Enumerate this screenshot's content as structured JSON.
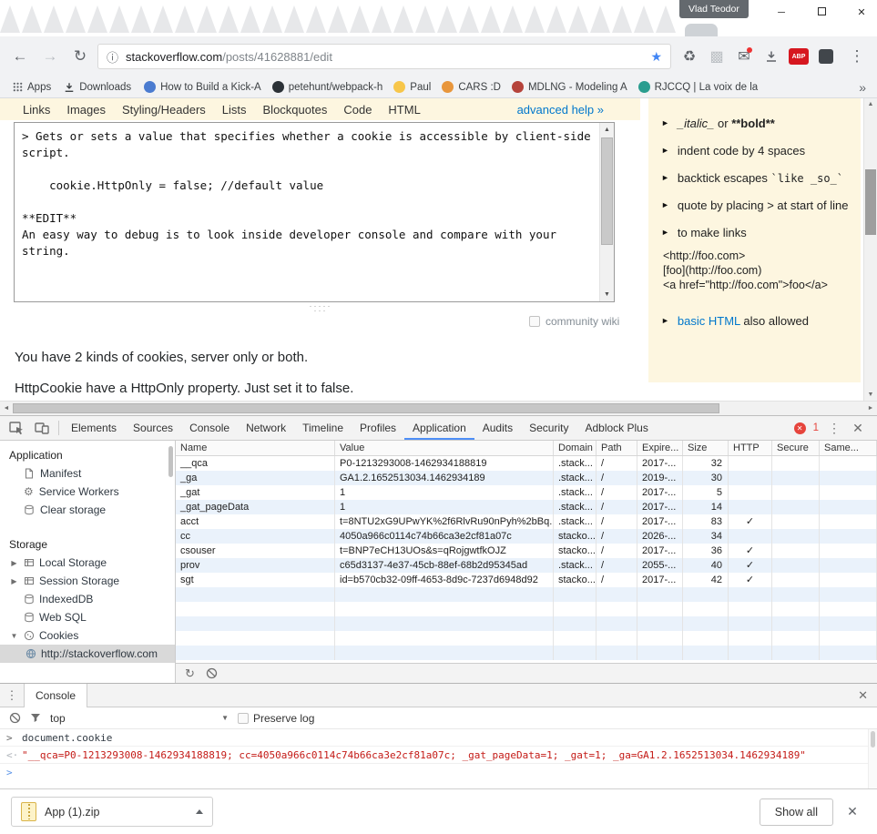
{
  "titlebar": {
    "profile_name": "Vlad Teodor"
  },
  "navbar": {
    "url_host": "stackoverflow.com",
    "url_path": "/posts/41628881/edit",
    "abp_label": "ABP"
  },
  "bookmarks_bar": {
    "apps_label": "Apps",
    "downloads_label": "Downloads",
    "items": [
      {
        "label": "How to Build a Kick-A",
        "color": "#4a7bd0"
      },
      {
        "label": "petehunt/webpack-h",
        "color": "#2b3137"
      },
      {
        "label": "Paul",
        "color": "#f7c64a"
      },
      {
        "label": "CARS :D",
        "color": "#e8963c"
      },
      {
        "label": "MDLNG - Modeling A",
        "color": "#b5433b"
      },
      {
        "label": "RJCCQ | La voix de la",
        "color": "#2a9d8f"
      }
    ],
    "overflow": "»"
  },
  "editor": {
    "toolbar_tabs": [
      "Links",
      "Images",
      "Styling/Headers",
      "Lists",
      "Blockquotes",
      "Code",
      "HTML"
    ],
    "advanced_help": "advanced help »",
    "content": "> Gets or sets a value that specifies whether a cookie is accessible by client-side script.\n\n    cookie.HttpOnly = false; //default value\n\n**EDIT**\nAn easy way to debug is to look inside developer console and compare with your string.",
    "community_wiki_label": "community wiki"
  },
  "help_panel": {
    "bullet": "►",
    "item1": {
      "italic": "_italic_",
      "mid": " or ",
      "bold": "**bold**"
    },
    "item2": "indent code by 4 spaces",
    "item3_pre": "backtick escapes ",
    "item3_code": "`like _so_`",
    "item4": "quote by placing > at start of line",
    "item5": "to make links",
    "link_examples": [
      "<http://foo.com>",
      "[foo](http://foo.com)",
      "<a href=\"http://foo.com\">foo</a>"
    ],
    "item6_link": "basic HTML",
    "item6_rest": " also allowed"
  },
  "post_body": {
    "line1": "You have 2 kinds of cookies, server only or both.",
    "line2": "HttpCookie have a HttpOnly property. Just set it to false."
  },
  "devtools": {
    "tabs": [
      "Elements",
      "Sources",
      "Console",
      "Network",
      "Timeline",
      "Profiles",
      "Application",
      "Audits",
      "Security",
      "Adblock Plus"
    ],
    "active_tab": "Application",
    "error_count": "1",
    "sidebar": {
      "section1": "Application",
      "app_items": [
        "Manifest",
        "Service Workers",
        "Clear storage"
      ],
      "section2": "Storage",
      "storage_items": [
        {
          "label": "Local Storage",
          "arrow": "▶"
        },
        {
          "label": "Session Storage",
          "arrow": "▶"
        },
        {
          "label": "IndexedDB",
          "arrow": ""
        },
        {
          "label": "Web SQL",
          "arrow": ""
        },
        {
          "label": "Cookies",
          "arrow": "▼"
        }
      ],
      "selected_cookie_origin": "http://stackoverflow.com"
    },
    "cookie_table": {
      "columns": [
        "Name",
        "Value",
        "Domain",
        "Path",
        "Expire...",
        "Size",
        "HTTP",
        "Secure",
        "Same..."
      ],
      "rows": [
        {
          "name": "__qca",
          "value": "P0-1213293008-1462934188819",
          "domain": ".stack...",
          "path": "/",
          "expires": "2017-...",
          "size": "32",
          "http": "",
          "secure": "",
          "same": ""
        },
        {
          "name": "_ga",
          "value": "GA1.2.1652513034.1462934189",
          "domain": ".stack...",
          "path": "/",
          "expires": "2019-...",
          "size": "30",
          "http": "",
          "secure": "",
          "same": ""
        },
        {
          "name": "_gat",
          "value": "1",
          "domain": ".stack...",
          "path": "/",
          "expires": "2017-...",
          "size": "5",
          "http": "",
          "secure": "",
          "same": ""
        },
        {
          "name": "_gat_pageData",
          "value": "1",
          "domain": ".stack...",
          "path": "/",
          "expires": "2017-...",
          "size": "14",
          "http": "",
          "secure": "",
          "same": ""
        },
        {
          "name": "acct",
          "value": "t=8NTU2xG9UPwYK%2f6RlvRu90nPyh%2bBq...",
          "domain": ".stack...",
          "path": "/",
          "expires": "2017-...",
          "size": "83",
          "http": "✓",
          "secure": "",
          "same": ""
        },
        {
          "name": "cc",
          "value": "4050a966c0114c74b66ca3e2cf81a07c",
          "domain": "stacko...",
          "path": "/",
          "expires": "2026-...",
          "size": "34",
          "http": "",
          "secure": "",
          "same": ""
        },
        {
          "name": "csouser",
          "value": "t=BNP7eCH13UOs&s=qRojgwtfkOJZ",
          "domain": "stacko...",
          "path": "/",
          "expires": "2017-...",
          "size": "36",
          "http": "✓",
          "secure": "",
          "same": ""
        },
        {
          "name": "prov",
          "value": "c65d3137-4e37-45cb-88ef-68b2d95345ad",
          "domain": ".stack...",
          "path": "/",
          "expires": "2055-...",
          "size": "40",
          "http": "✓",
          "secure": "",
          "same": ""
        },
        {
          "name": "sgt",
          "value": "id=b570cb32-09ff-4653-8d9c-7237d6948d92",
          "domain": "stacko...",
          "path": "/",
          "expires": "2017-...",
          "size": "42",
          "http": "✓",
          "secure": "",
          "same": ""
        }
      ]
    },
    "console": {
      "tab_label": "Console",
      "context_label": "top",
      "preserve_log_label": "Preserve log",
      "command": "document.cookie",
      "result": "\"__qca=P0-1213293008-1462934188819; cc=4050a966c0114c74b66ca3e2cf81a07c; _gat_pageData=1; _gat=1; _ga=GA1.2.1652513034.1462934189\""
    }
  },
  "downloads_bar": {
    "filename": "App (1).zip",
    "show_all_label": "Show all"
  }
}
